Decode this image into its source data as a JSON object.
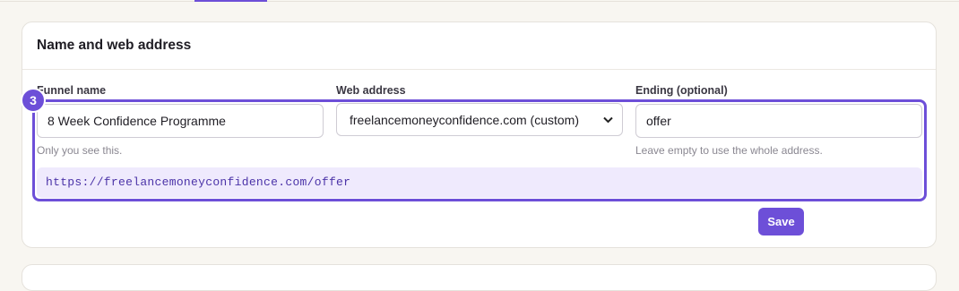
{
  "section": {
    "title": "Name and web address"
  },
  "step": {
    "number": "3"
  },
  "fields": {
    "funnel_name": {
      "label": "Funnel name",
      "value": "8 Week Confidence Programme",
      "help": "Only you see this."
    },
    "web_address": {
      "label": "Web address",
      "selected": "freelancemoneyconfidence.com (custom)"
    },
    "ending": {
      "label": "Ending (optional)",
      "value": "offer",
      "help": "Leave empty to use the whole address."
    }
  },
  "url_preview": "https://freelancemoneyconfidence.com/offer",
  "actions": {
    "save_label": "Save"
  },
  "colors": {
    "accent": "#6d4fd8",
    "preview_bg": "#efeafd",
    "page_bg": "#f8f6f1"
  },
  "icons": {
    "select_arrow": "chevron-down-icon"
  }
}
